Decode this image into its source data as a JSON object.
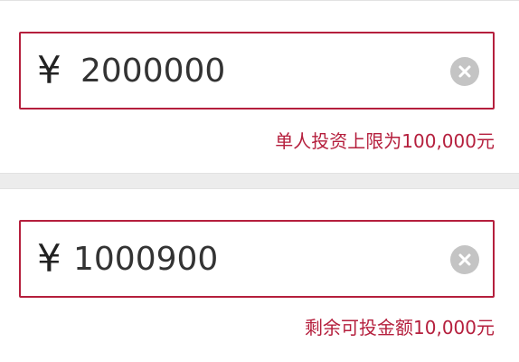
{
  "investment": {
    "currency_symbol": "¥",
    "amount": "2000000",
    "limit_hint": "单人投资上限为100,000元",
    "clear_icon": "clear-circle-icon"
  },
  "remaining": {
    "currency_symbol": "¥",
    "amount": "1000900",
    "remaining_hint": "剩余可投金额10,000元",
    "clear_icon": "clear-circle-icon"
  },
  "colors": {
    "accent": "#b51f3d",
    "clear_button": "#c4c4c4",
    "text": "#333333",
    "page_background": "#ececec"
  }
}
